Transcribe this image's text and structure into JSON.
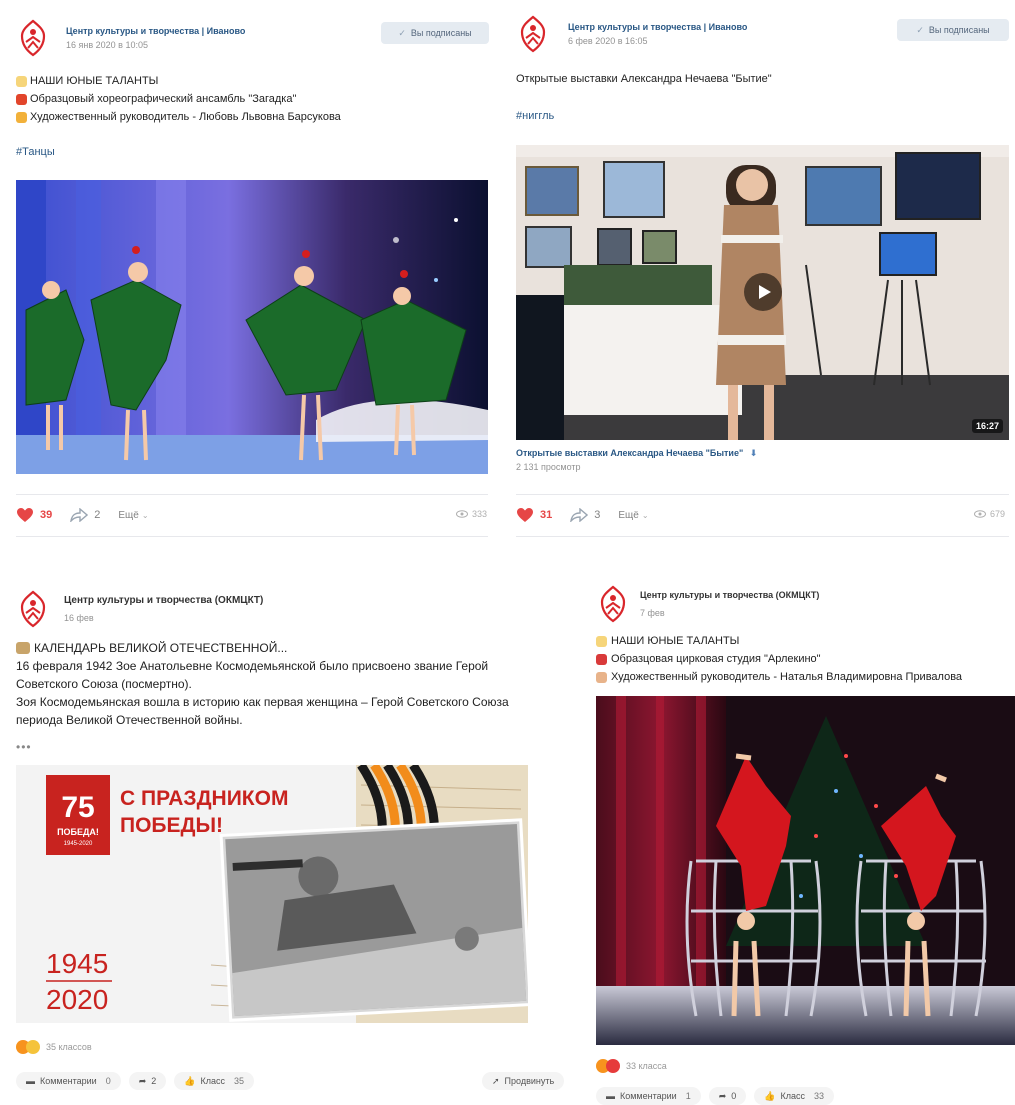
{
  "posts": [
    {
      "author": "Центр культуры и творчества | Иваново",
      "date": "16 янв 2020 в 10:05",
      "subscribed_label": "Вы подписаны",
      "lines": [
        "НАШИ ЮНЫЕ ТАЛАНТЫ",
        "Образцовый хореографический ансамбль \"Загадка\"",
        "Художественный руководитель - Любовь Львовна Барсукова"
      ],
      "line_icons": [
        "sparkle-icon",
        "flame-icon",
        "clap-hands-icon"
      ],
      "hashtag": "#Танцы",
      "likes": "39",
      "shares": "2",
      "more_label": "Ещё",
      "views": "333"
    },
    {
      "author": "Центр культуры и творчества | Иваново",
      "date": "6 фев 2020 в 16:05",
      "subscribed_label": "Вы подписаны",
      "lines": [
        "Открытые выставки Александра Нечаева \"Бытие\""
      ],
      "hashtag": "#ниггль",
      "video_title": "Открытые выставки Александра Нечаева \"Бытие\"",
      "video_views": "2 131 просмотр",
      "duration": "16:27",
      "likes": "31",
      "shares": "3",
      "more_label": "Ещё",
      "views": "679"
    },
    {
      "author": "Центр культуры и творчества (ОКМЦКТ)",
      "date": "16 фев",
      "lines": [
        "КАЛЕНДАРЬ ВЕЛИКОЙ ОТЕЧЕСТВЕННОЙ...",
        "16 февраля 1942 Зое Анатольевне Космодемьянской было присвоено звание Герой",
        "Советского Союза (посмертно).",
        "Зоя Космодемьянская вошла в историю как первая женщина – Герой Советского Союза",
        "периода Великой Отечественной войны."
      ],
      "ellipsis": "•••",
      "poster": {
        "logo_number": "75",
        "logo_text": "ПОБЕДА!",
        "logo_years": "1945-2020",
        "headline_1": "С ПРАЗДНИКОМ",
        "headline_2": "ПОБЕДЫ!",
        "year_1": "1945",
        "year_2": "2020"
      },
      "reactions_label": "35 классов",
      "comments_label": "Комментарии",
      "comments_count": "0",
      "reshares_count": "2",
      "class_label": "Класс",
      "class_count": "35",
      "promote_label": "Продвинуть"
    },
    {
      "author": "Центр культуры и творчества (ОКМЦКТ)",
      "date": "7 фев",
      "lines": [
        "НАШИ ЮНЫЕ ТАЛАНТЫ",
        "Образцовая цирковая студия \"Арлекино\"",
        "Художественный руководитель - Наталья Владимировна Привалова"
      ],
      "line_icons": [
        "sparkle-icon",
        "lipstick-icon",
        "clap-hands-icon"
      ],
      "reactions_label": "33 класса",
      "comments_label": "Комментарии",
      "comments_count": "1",
      "reshares_count": "0",
      "class_label": "Класс",
      "class_count": "33"
    }
  ],
  "colors": {
    "link": "#2a5885",
    "like_red": "#e64646",
    "logo_red": "#d9262b",
    "poster_red": "#c8231f",
    "ok_orange": "#f7931e"
  }
}
